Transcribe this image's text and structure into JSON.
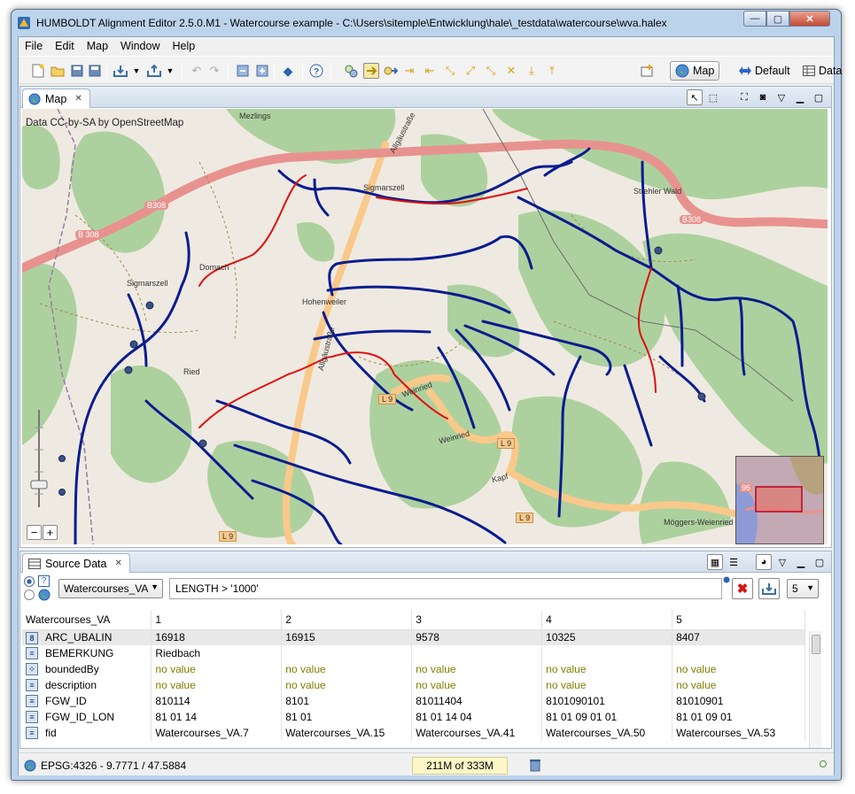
{
  "window": {
    "title": "HUMBOLDT Alignment Editor 2.5.0.M1 - Watercourse example - C:\\Users\\sitemple\\Entwicklung\\hale\\_testdata\\watercourse\\wva.halex",
    "minimize": "—",
    "maximize": "▢",
    "close": "✕"
  },
  "menu": [
    "File",
    "Edit",
    "Map",
    "Window",
    "Help"
  ],
  "perspectives": {
    "map": "Map",
    "default": "Default",
    "data": "Data"
  },
  "map_view": {
    "tab_label": "Map",
    "attribution": "Data CC-by-SA by OpenStreetMap",
    "zoom_minus": "−",
    "zoom_plus": "+",
    "labels": {
      "mezlings": "Mezlings",
      "allgaustrasse_n": "Allgäustraße",
      "sigmarszell_n": "Sigmarszell",
      "strehler_wald": "Strehler Wald",
      "b308_w": "B308",
      "b308_w2": "B 308",
      "b308_e": "B308",
      "domach": "Domach",
      "sigmarszell_w": "Sigmarszell",
      "hohenweiler": "Hohenweiler",
      "allgaustrasse_s": "Allgäustraße",
      "ried": "Ried",
      "l9_a": "L 9",
      "weinried_a": "Weinried",
      "weinried_b": "Weinried",
      "l9_b": "L 9",
      "kapf": "Kapf",
      "l9_c": "L 9",
      "l9_d": "L 9",
      "moggers": "Möggers-Weienried",
      "overview_label": "96"
    }
  },
  "source_view": {
    "tab_label": "Source Data",
    "radio_top_label": "?",
    "feature_type": "Watercourses_VA",
    "filter": "LENGTH > '1000'",
    "count": "5",
    "table": {
      "columns": [
        "Watercourses_VA",
        "1",
        "2",
        "3",
        "4",
        "5"
      ],
      "rows": [
        {
          "name": "ARC_UBALIN",
          "icon": "8",
          "values": [
            "16918",
            "16915",
            "9578",
            "10325",
            "8407"
          ]
        },
        {
          "name": "BEMERKUNG",
          "icon": "≡",
          "values": [
            "Riedbach",
            "",
            "",
            "",
            ""
          ]
        },
        {
          "name": "boundedBy",
          "icon": "⁘",
          "values": [
            "no value",
            "no value",
            "no value",
            "no value",
            "no value"
          ]
        },
        {
          "name": "description",
          "icon": "≡",
          "values": [
            "no value",
            "no value",
            "no value",
            "no value",
            "no value"
          ]
        },
        {
          "name": "FGW_ID",
          "icon": "≡",
          "values": [
            "810114",
            "8101",
            "81011404",
            "8101090101",
            "81010901"
          ]
        },
        {
          "name": "FGW_ID_LON",
          "icon": "≡",
          "values": [
            "81 01 14",
            "81 01",
            "81 01 14 04",
            "81 01 09 01 01",
            "81 01 09 01"
          ]
        },
        {
          "name": "fid",
          "icon": "≡",
          "values": [
            "Watercourses_VA.7",
            "Watercourses_VA.15",
            "Watercourses_VA.41",
            "Watercourses_VA.50",
            "Watercourses_VA.53"
          ]
        }
      ]
    }
  },
  "status": {
    "crs": "EPSG:4326 - 9.7771 / 47.5884",
    "heap": "211M of 333M"
  },
  "colors": {
    "forest": "#add19e",
    "land": "#efeae1",
    "river": "#0b1c8f",
    "selected_river": "#e01010",
    "major_road": "#e8928f",
    "minor_road": "#f9c98b"
  }
}
